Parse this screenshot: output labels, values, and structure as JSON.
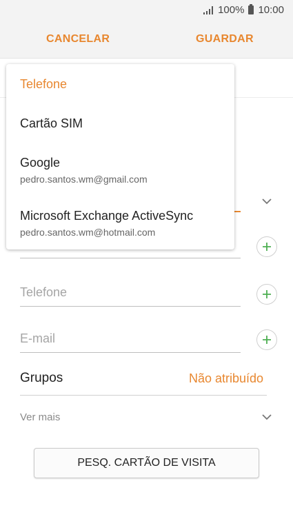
{
  "status_bar": {
    "battery_pct": "100%",
    "time": "10:00"
  },
  "action_bar": {
    "cancel_label": "CANCELAR",
    "save_label": "GUARDAR"
  },
  "form": {
    "phone_placeholder": "Telefone",
    "email_placeholder": "E-mail",
    "groups_label": "Grupos",
    "groups_value": "Não atribuído",
    "more_label": "Ver mais",
    "scan_button_label": "PESQ. CARTÃO DE VISITA"
  },
  "storage_dropdown": {
    "items": [
      {
        "title": "Telefone",
        "subtitle": "",
        "selected": true
      },
      {
        "title": "Cartão SIM",
        "subtitle": ""
      },
      {
        "title": "Google",
        "subtitle": "pedro.santos.wm@gmail.com"
      },
      {
        "title": "Microsoft Exchange ActiveSync",
        "subtitle": "pedro.santos.wm@hotmail.com"
      }
    ]
  },
  "icons": {
    "add": "plus-circle-icon",
    "expand": "chevron-down-icon",
    "signal": "signal-icon",
    "battery": "battery-icon"
  },
  "colors": {
    "accent": "#e8872f",
    "add_green": "#4caf50"
  }
}
